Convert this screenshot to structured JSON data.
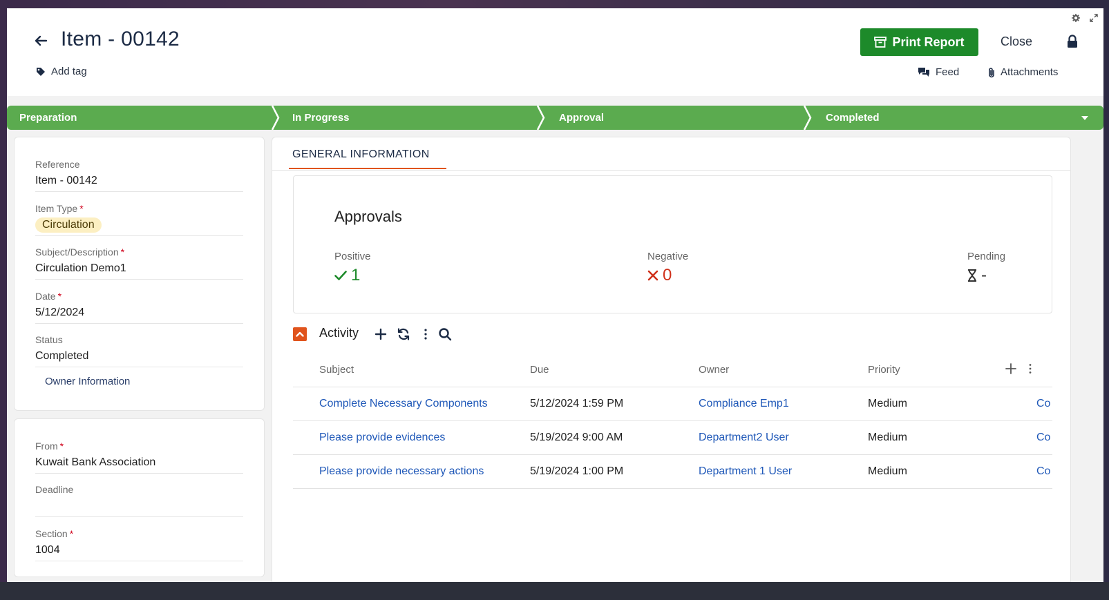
{
  "header": {
    "title": "Item - 00142",
    "add_tag": "Add tag",
    "print_report": "Print Report",
    "close": "Close",
    "feed": "Feed",
    "attachments": "Attachments"
  },
  "stages": [
    "Preparation",
    "In Progress",
    "Approval",
    "Completed"
  ],
  "colors": {
    "stage_green": "#5bab4f",
    "print_green": "#1d8a2a",
    "accent_orange": "#e0541d",
    "link_blue": "#1f58b8",
    "positive_green": "#1d8a2a",
    "negative_red": "#d0311b"
  },
  "details": {
    "reference_label": "Reference",
    "reference_value": "Item - 00142",
    "item_type_label": "Item Type",
    "item_type_value": "Circulation",
    "subject_label": "Subject/Description",
    "subject_value": "Circulation Demo1",
    "date_label": "Date",
    "date_value": "5/12/2024",
    "status_label": "Status",
    "status_value": "Completed",
    "owner_info": "Owner Information"
  },
  "details2": {
    "from_label": "From",
    "from_value": "Kuwait Bank Association",
    "deadline_label": "Deadline",
    "deadline_value": "",
    "section_label": "Section",
    "section_value": "1004"
  },
  "tab": "GENERAL INFORMATION",
  "approvals": {
    "title": "Approvals",
    "positive_label": "Positive",
    "positive_value": "1",
    "negative_label": "Negative",
    "negative_value": "0",
    "pending_label": "Pending",
    "pending_value": "-"
  },
  "activity": {
    "title": "Activity",
    "columns": [
      "Subject",
      "Due",
      "Owner",
      "Priority"
    ],
    "rows": [
      {
        "subject": "Complete Necessary Components",
        "due": "5/12/2024 1:59 PM",
        "owner": "Compliance Emp1",
        "priority": "Medium",
        "extra": "Co"
      },
      {
        "subject": "Please provide evidences",
        "due": "5/19/2024 9:00 AM",
        "owner": "Department2 User",
        "priority": "Medium",
        "extra": "Co"
      },
      {
        "subject": "Please provide necessary actions",
        "due": "5/19/2024 1:00 PM",
        "owner": "Department 1 User",
        "priority": "Medium",
        "extra": "Co"
      }
    ]
  }
}
